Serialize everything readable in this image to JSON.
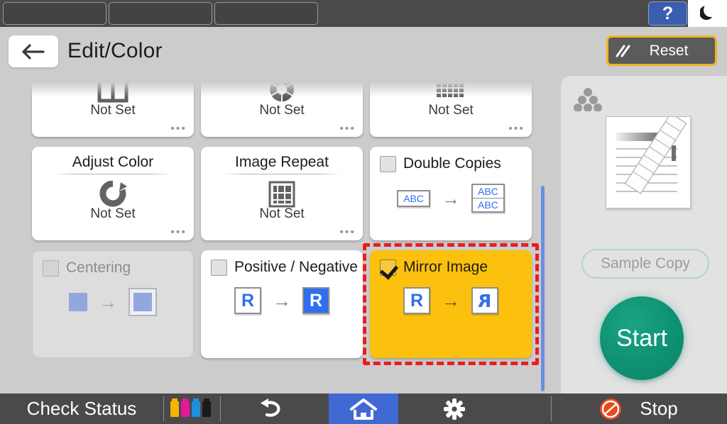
{
  "window": {
    "tabs": [
      {
        "label": ""
      },
      {
        "label": ""
      },
      {
        "label": ""
      }
    ],
    "help_label": "?",
    "sleep_icon": "moon-icon"
  },
  "header": {
    "back_icon": "back-arrow-icon",
    "title": "Edit/Color",
    "reset_label": "Reset",
    "reset_icon": "reset-slashes-icon",
    "reset_border_color": "#f0b41e"
  },
  "content": {
    "rows": [
      {
        "cards": [
          {
            "icon": "two-page-columns-icon",
            "status": "Not Set",
            "more": "•••"
          },
          {
            "icon": "color-wheel-icon",
            "status": "Not Set",
            "more": "•••"
          },
          {
            "icon": "halftone-grid-icon",
            "status": "Not Set",
            "more": "•••"
          }
        ]
      },
      {
        "cards": [
          {
            "title": "Adjust Color",
            "icon": "color-rotate-icon",
            "status": "Not Set",
            "more": "•••"
          },
          {
            "title": "Image Repeat",
            "icon": "grid-3x3-icon",
            "status": "Not Set",
            "more": "•••"
          },
          {
            "title": "Double Copies",
            "checked": false,
            "from_label": "ABC",
            "to_label_top": "ABC",
            "to_label_bottom": "ABC",
            "arrow": "→"
          }
        ]
      },
      {
        "cards": [
          {
            "title": "Centering",
            "checked": false,
            "disabled": true,
            "arrow": "→"
          },
          {
            "title": "Positive / Negative",
            "checked": false,
            "from_label": "R",
            "to_label": "R",
            "arrow": "→"
          },
          {
            "title": "Mirror Image",
            "checked": true,
            "selected": true,
            "from_label": "R",
            "to_label": "R",
            "arrow": "→"
          }
        ]
      }
    ],
    "selection_highlight_color": "#ee1c1c",
    "scrollbar_color": "#6b8fe0",
    "selected_card_color": "#fcc10e"
  },
  "right_panel": {
    "stack_icon": "document-stack-icon",
    "preview_icon": "document-preview-image",
    "sample_copy_label": "Sample Copy",
    "sample_copy_enabled": false,
    "start_label": "Start",
    "start_color": "#0e9173"
  },
  "bottom_bar": {
    "check_status_label": "Check Status",
    "toner": [
      {
        "name": "toner-yellow",
        "color": "#f5b400"
      },
      {
        "name": "toner-magenta",
        "color": "#e5189b"
      },
      {
        "name": "toner-cyan",
        "color": "#1d8fe0"
      },
      {
        "name": "toner-black",
        "color": "#1a1a1a"
      }
    ],
    "undo_icon": "undo-arrow-icon",
    "home_icon": "home-icon",
    "home_active_color": "#4169d4",
    "settings_icon": "gear-icon",
    "stop_icon": "stop-icon",
    "stop_label": "Stop",
    "stop_color": "#e8491c"
  }
}
